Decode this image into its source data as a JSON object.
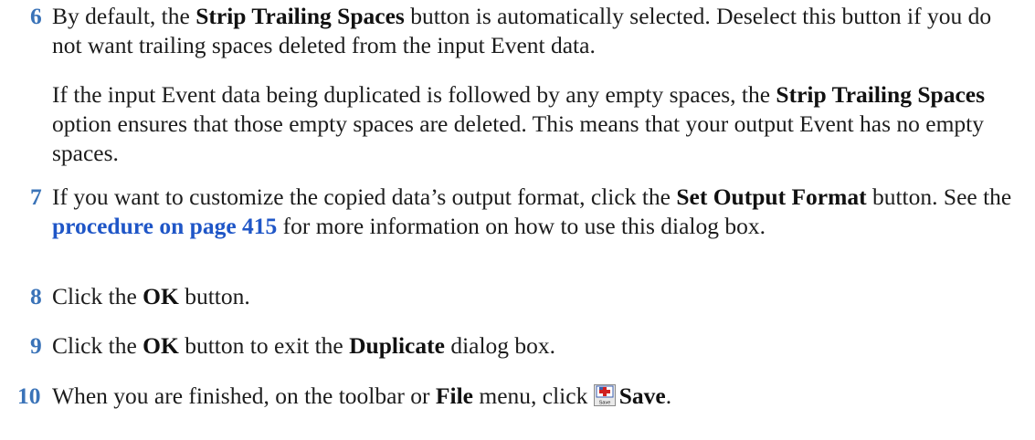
{
  "step6": {
    "number": "6",
    "t1": "By default, the ",
    "b1": "Strip Trailing Spaces",
    "t2": " button is automatically selected. Deselect this button if you do not want trailing spaces deleted from the input Event data."
  },
  "para6": {
    "t1": "If the input Event data being duplicated is followed by any empty spaces, the ",
    "b1": "Strip Trailing Spaces",
    "t2": " option ensures that those empty spaces are deleted. This means that your output Event has no empty spaces."
  },
  "step7": {
    "number": "7",
    "t1": "If you want to customize the copied data’s output format, click the ",
    "b1": "Set Output Format",
    "t2": " button. See the ",
    "link": "procedure on page 415",
    "t3": " for more information on how to use this dialog box."
  },
  "step8": {
    "number": "8",
    "t1": "Click the ",
    "b1": "OK",
    "t2": " button."
  },
  "step9": {
    "number": "9",
    "t1": "Click the ",
    "b1": "OK",
    "t2": " button to exit the ",
    "b2": "Duplicate",
    "t3": " dialog box."
  },
  "step10": {
    "number": "10",
    "t1": "When you are finished, on the toolbar or ",
    "b1": "File",
    "t2": " menu, click ",
    "icon": "save-icon",
    "icon_label": "Save",
    "b2": "Save",
    "t3": "."
  },
  "colors": {
    "step_number": "#3a73b8",
    "link": "#1f56c7",
    "text": "#1c1c1c"
  }
}
